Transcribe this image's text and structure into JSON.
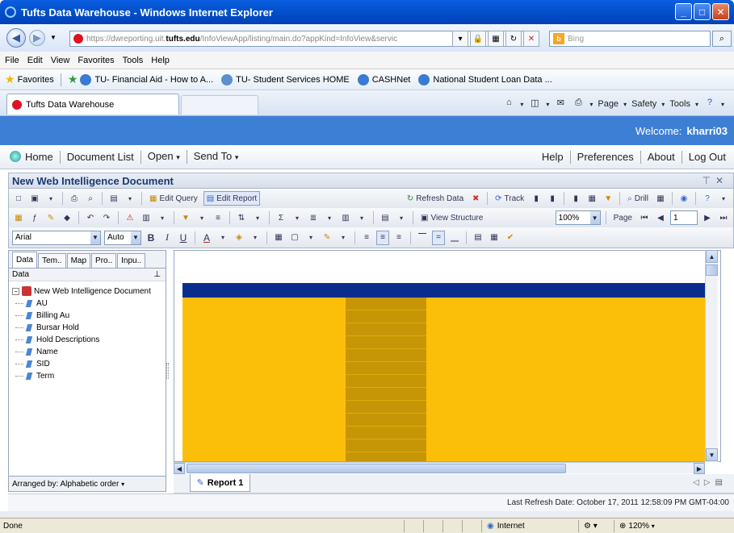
{
  "window": {
    "title": "Tufts Data Warehouse - Windows Internet Explorer"
  },
  "address": {
    "prefix": "https://dwreporting.uit.",
    "domain": "tufts.edu",
    "path": "/InfoViewApp/listing/main.do?appKind=InfoView&servic"
  },
  "search": {
    "placeholder": "Bing"
  },
  "menu": [
    "File",
    "Edit",
    "View",
    "Favorites",
    "Tools",
    "Help"
  ],
  "favorites": {
    "label": "Favorites",
    "items": [
      "TU- Financial Aid - How to A...",
      "TU- Student Services HOME",
      "CASHNet",
      "National Student Loan Data ..."
    ]
  },
  "tab": {
    "title": "Tufts Data Warehouse"
  },
  "command": {
    "page": "Page",
    "safety": "Safety",
    "tools": "Tools"
  },
  "welcome": {
    "label": "Welcome:",
    "user": "kharri03"
  },
  "appnav": {
    "home": "Home",
    "doclist": "Document List",
    "open": "Open",
    "sendto": "Send To",
    "help": "Help",
    "preferences": "Preferences",
    "about": "About",
    "logout": "Log Out"
  },
  "document": {
    "title": "New Web Intelligence Document"
  },
  "toolbar1": {
    "edit_query": "Edit Query",
    "edit_report": "Edit Report",
    "refresh_data": "Refresh Data",
    "track": "Track",
    "drill": "Drill"
  },
  "toolbar2": {
    "view_structure": "View Structure",
    "zoom": "100%",
    "page_label": "Page",
    "page_value": "1"
  },
  "toolbar3": {
    "font": "Arial",
    "size": "Auto"
  },
  "leftpanel": {
    "tabs": [
      "Data",
      "Tem..",
      "Map",
      "Pro..",
      "Inpu.."
    ],
    "header": "Data",
    "root": "New Web Intelligence Document",
    "objects": [
      "AU",
      "Billing Au",
      "Bursar Hold",
      "Hold Descriptions",
      "Name",
      "SID",
      "Term"
    ],
    "footer": "Arranged by: Alphabetic order"
  },
  "report": {
    "tab": "Report 1",
    "refresh": "Last Refresh Date: October 17, 2011 12:58:09 PM GMT-04:00",
    "colors": {
      "header": "#0a2d8d",
      "body": "#fcbf09",
      "column": "#c79607"
    }
  },
  "status": {
    "done": "Done",
    "zone": "Internet",
    "zoom": "120%"
  }
}
